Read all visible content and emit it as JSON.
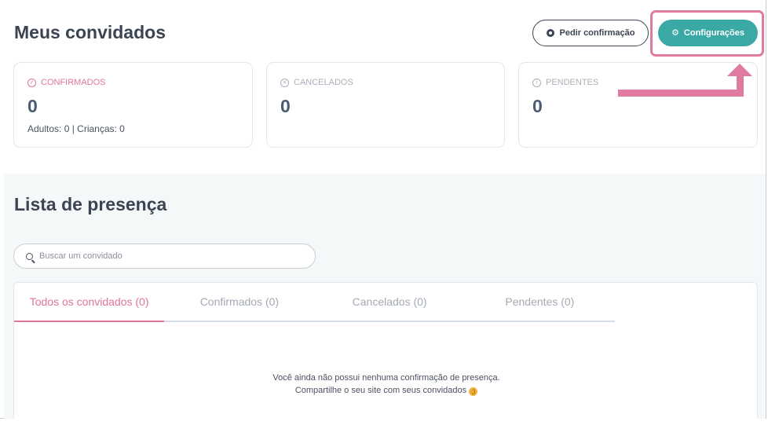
{
  "header": {
    "title": "Meus convidados",
    "whatsapp_button_label": "Pedir confirmação",
    "config_button_label": "Configurações"
  },
  "summary_cards": [
    {
      "label": "CONFIRMADOS",
      "icon": "check-circle-icon",
      "count": "0",
      "detail": "Adultos: 0 | Crianças: 0",
      "color": "#e0749e"
    },
    {
      "label": "CANCELADOS",
      "icon": "x-circle-icon",
      "count": "0",
      "color": "#a9b0ba"
    },
    {
      "label": "PENDENTES",
      "icon": "info-circle-icon",
      "count": "0",
      "color": "#a9b0ba"
    }
  ],
  "presence": {
    "title": "Lista de presença",
    "search_placeholder": "Buscar um convidado",
    "tabs": [
      {
        "label": "Todos os convidados (0)",
        "active": true
      },
      {
        "label": "Confirmados (0)",
        "active": false
      },
      {
        "label": "Cancelados (0)",
        "active": false
      },
      {
        "label": "Pendentes (0)",
        "active": false
      }
    ],
    "empty_line1": "Você ainda não possui nenhuma confirmação de presença.",
    "empty_line2": "Compartilhe o seu site com seus convidados",
    "emoji": "wink-emoji-icon"
  },
  "colors": {
    "accent_pink": "#e0749e",
    "accent_teal": "#3aa9a6",
    "text_dark": "#3b4452",
    "section_bg": "#f4f8f9"
  }
}
